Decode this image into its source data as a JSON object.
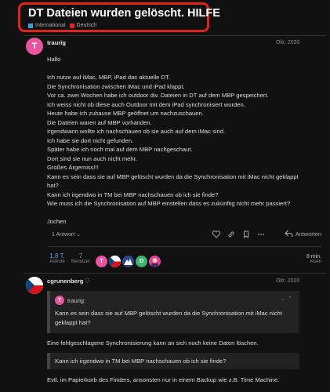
{
  "topic": {
    "title": "DT Dateien wurden gelöscht. HILFE",
    "categories": [
      {
        "label": "International",
        "color": "#3a9ed9"
      },
      {
        "label": "Deutsch",
        "color": "#e2231a"
      }
    ]
  },
  "post1": {
    "avatar_letter": "T",
    "avatar_color": "#e8549e",
    "username": "traurig",
    "date": "Okt. 2020",
    "lines": [
      "Hallo",
      "",
      "Ich nutze auf iMac, MBP, iPad das aktuelle DT.",
      "Die Synchronisation zwischen iMac und iPad klappt.",
      "Vor ca. zwei Wochen habe ich outdoor div. Dateien in DT auf dem MBP gespeichert.",
      "Ich weiss nicht ob diese auch Outdoor mit dem iPad synchronisiert wurden.",
      "Heute habe ich zuhause MBP geöffnet um nachzuschauen.",
      "Die Dateien waren auf MBP vorhanden.",
      "Irgendwann wollte ich nachschauen ob sie auch auf dem iMac sind.",
      "Ich habe sie dort nicht gefunden.",
      "Später habe ich noch mal auf dem MBP nachgeschaut.",
      "Dort sind sie nun auch nicht mehr.",
      "Großes Ärgerniss!!!",
      "Kann es sein dass sie auf MBP gelöscht wurden da die Synchronisation mit iMac nicht geklappt",
      "hat?",
      "Kann ich irgendwo in TM bei MBP nachschauen ob ich sie finde?",
      "Wie muss ich die Synchronisation auf MBP einstellen dass es zukünftig nicht mehr passiert?",
      "",
      "Jochen"
    ],
    "replies_label": "1 Antwort",
    "answer_label": "Antworten",
    "stats": {
      "views_value": "1,8 T.",
      "views_label": "Aufrufe",
      "users_value": "7",
      "users_label": "Benutzer",
      "read_value": "8 min.",
      "read_label": "lesen"
    },
    "participants": [
      {
        "letter": "T",
        "color": "#e8549e"
      },
      {
        "letter": "",
        "color": "#ffffff"
      },
      {
        "letter": "",
        "color": "#2c4a8a"
      },
      {
        "letter": "D",
        "color": "#3cb371"
      },
      {
        "letter": "",
        "color": "#e040a0"
      }
    ]
  },
  "post2": {
    "username": "cgrunenberg",
    "date": "Okt. 2020",
    "quote1": {
      "user": "traurig:",
      "avatar_letter": "T",
      "lines": [
        "Kann es sein dass sie auf MBP gelöscht wurden da die Synchronisation mit iMac nicht",
        "geklappt hat?"
      ]
    },
    "text1": "Eine fehlgeschlagene Synchronisierung kann an sich noch keine Daten löschen.",
    "quote2": {
      "lines": [
        "Kann ich irgendwo in TM bei MBP nachschauen ob ich sie finde?"
      ]
    },
    "text2": "Evtl. im Papierkorb des Finders, ansonsten nur in einem Backup wie z.B. Time Machine."
  }
}
